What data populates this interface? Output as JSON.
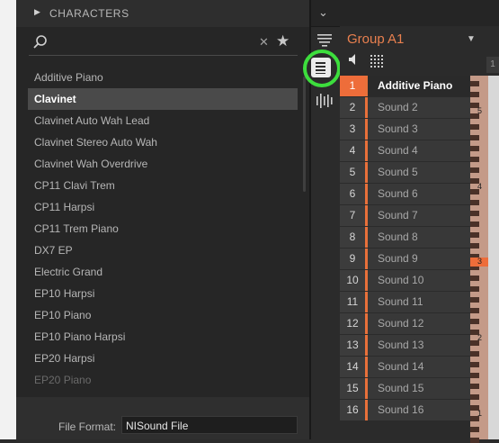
{
  "browser": {
    "section_title": "CHARACTERS",
    "search": {
      "value": "",
      "placeholder": ""
    },
    "items": [
      {
        "label": "Additive Piano"
      },
      {
        "label": "Clavinet",
        "selected": true
      },
      {
        "label": "Clavinet Auto Wah Lead"
      },
      {
        "label": "Clavinet Stereo Auto Wah"
      },
      {
        "label": "Clavinet Wah Overdrive"
      },
      {
        "label": "CP11 Clavi Trem"
      },
      {
        "label": "CP11 Harpsi"
      },
      {
        "label": "CP11 Trem Piano"
      },
      {
        "label": "DX7 EP"
      },
      {
        "label": "Electric Grand"
      },
      {
        "label": "EP10 Harpsi"
      },
      {
        "label": "EP10 Piano"
      },
      {
        "label": "EP10 Piano Harpsi"
      },
      {
        "label": "EP20 Harpsi"
      },
      {
        "label": "EP20 Piano"
      }
    ],
    "file_format_label": "File Format:",
    "file_format_value": "NISound File"
  },
  "tools": {
    "icons": [
      "chevron-down-icon",
      "filter-icon",
      "list-view-icon",
      "mixer-icon"
    ]
  },
  "group": {
    "name": "Group A1",
    "column_hint": "1",
    "sounds": [
      {
        "num": "1",
        "name": "Additive Piano",
        "active": true
      },
      {
        "num": "2",
        "name": "Sound 2"
      },
      {
        "num": "3",
        "name": "Sound 3"
      },
      {
        "num": "4",
        "name": "Sound 4"
      },
      {
        "num": "5",
        "name": "Sound 5"
      },
      {
        "num": "6",
        "name": "Sound 6"
      },
      {
        "num": "7",
        "name": "Sound 7"
      },
      {
        "num": "8",
        "name": "Sound 8"
      },
      {
        "num": "9",
        "name": "Sound 9"
      },
      {
        "num": "10",
        "name": "Sound 10"
      },
      {
        "num": "11",
        "name": "Sound 11"
      },
      {
        "num": "12",
        "name": "Sound 12"
      },
      {
        "num": "13",
        "name": "Sound 13"
      },
      {
        "num": "14",
        "name": "Sound 14"
      },
      {
        "num": "15",
        "name": "Sound 15"
      },
      {
        "num": "16",
        "name": "Sound 16"
      }
    ]
  },
  "keyboard": {
    "octave_labels": [
      "5",
      "4",
      "3",
      "2",
      "1"
    ],
    "active_octave": "3"
  },
  "colors": {
    "accent": "#ee6d3a",
    "highlight_ring": "#3dde3d",
    "selected_bg": "#4a4a4a"
  }
}
